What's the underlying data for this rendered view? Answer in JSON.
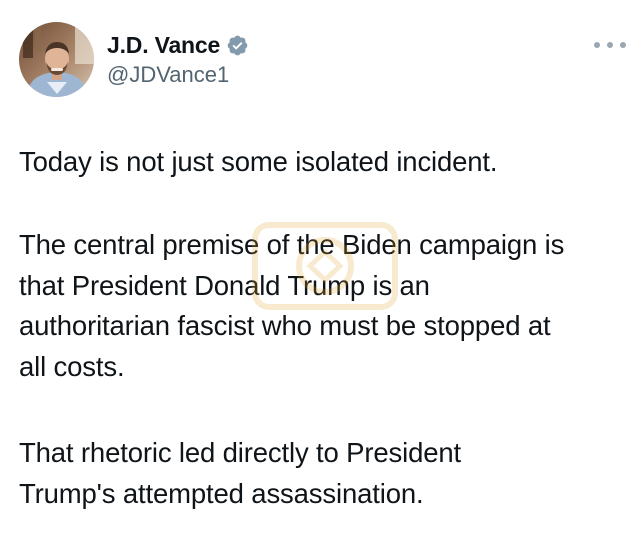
{
  "author": {
    "display_name": "J.D. Vance",
    "handle": "@JDVance1",
    "verified": true,
    "verified_icon": "verified-badge-icon",
    "verified_color": "#829aab"
  },
  "menu": {
    "icon": "more-options-icon"
  },
  "tweet": {
    "paragraphs": [
      {
        "lines": [
          "Today is not just some isolated incident."
        ]
      },
      {
        "lines": [
          "The central premise of the Biden campaign is",
          "that President Donald Trump is an",
          "authoritarian fascist who must be stopped at",
          "all costs."
        ]
      },
      {
        "lines": [
          "That rhetoric led directly to President",
          "Trump's attempted assassination."
        ]
      }
    ]
  },
  "colors": {
    "text": "#0f1419",
    "secondary_text": "#536471",
    "watermark": "#e0a52a"
  }
}
